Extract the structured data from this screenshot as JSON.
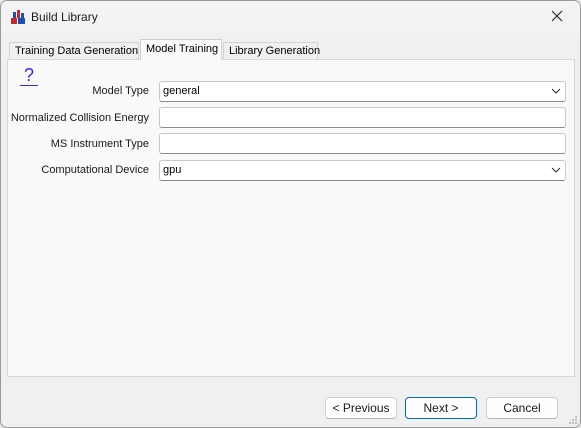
{
  "window": {
    "title": "Build Library",
    "app_icon": "build-library-icon",
    "close_icon": "close-icon"
  },
  "tabs": [
    {
      "label": "Training Data Generation",
      "active": false
    },
    {
      "label": "Model Training",
      "active": true
    },
    {
      "label": "Library Generation",
      "active": false
    }
  ],
  "panel": {
    "help_label": "?",
    "fields": {
      "model_type": {
        "label": "Model Type",
        "value": "general",
        "kind": "dropdown"
      },
      "collision_energy": {
        "label": "Normalized Collision Energy",
        "value": "",
        "kind": "text"
      },
      "instrument_type": {
        "label": "MS Instrument Type",
        "value": "",
        "kind": "text"
      },
      "device": {
        "label": "Computational Device",
        "value": "gpu",
        "kind": "dropdown"
      }
    }
  },
  "footer": {
    "previous_label": "< Previous",
    "next_label": "Next >",
    "cancel_label": "Cancel"
  },
  "colors": {
    "accent": "#0067c0",
    "help_link": "#2d2df0"
  }
}
